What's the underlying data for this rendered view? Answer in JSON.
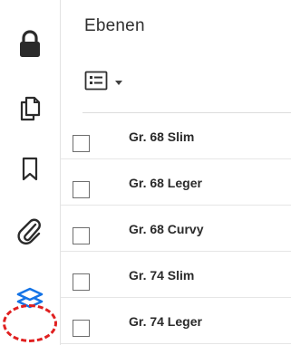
{
  "panel": {
    "title": "Ebenen"
  },
  "rail": {
    "items": [
      {
        "icon": "lock-icon"
      },
      {
        "icon": "pages-icon"
      },
      {
        "icon": "bookmark-icon"
      },
      {
        "icon": "paperclip-icon"
      },
      {
        "icon": "layers-icon",
        "active": true
      }
    ]
  },
  "toolbar": {
    "options_icon": "list-options-icon",
    "dropdown_icon": "chevron-down-icon"
  },
  "layers": [
    {
      "label": "Gr. 68 Slim",
      "checked": false
    },
    {
      "label": "Gr. 68 Leger",
      "checked": false
    },
    {
      "label": "Gr. 68 Curvy",
      "checked": false
    },
    {
      "label": "Gr. 74 Slim",
      "checked": false
    },
    {
      "label": "Gr. 74 Leger",
      "checked": false
    }
  ],
  "colors": {
    "icon": "#2b2b2b",
    "active_icon": "#1473e6",
    "highlight": "#e02020"
  }
}
